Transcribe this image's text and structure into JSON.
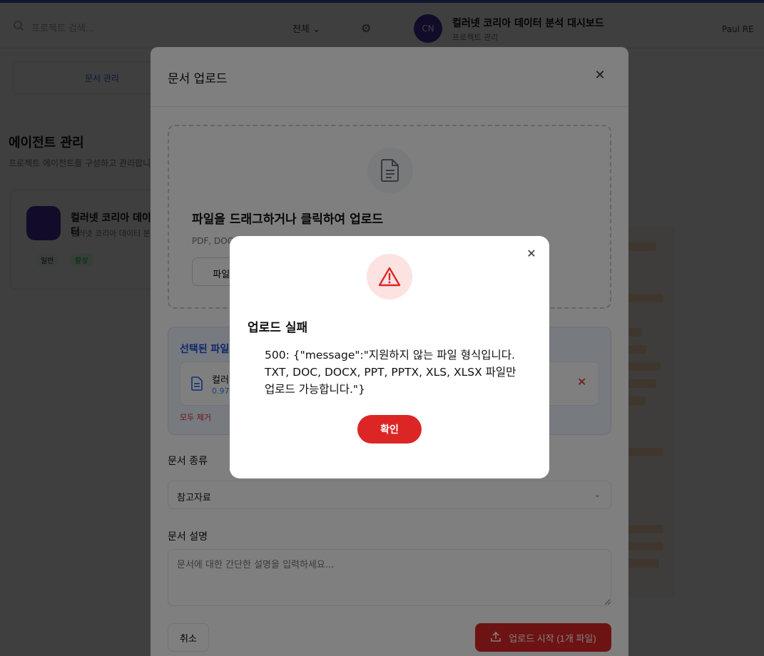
{
  "topbar": {
    "search_placeholder": "프로젝트 검색...",
    "filter_label": "전체",
    "project_logo": "CN",
    "project_title": "컬러넷 코리아 데이터 분석 대시보드",
    "project_subtitle": "프로젝트 관리",
    "user_label": "Paul RE"
  },
  "background": {
    "left_tab_label": "문서 관리",
    "page_heading": "에이전트 관리",
    "page_subheading": "프로젝트 에이전트를 구성하고 관리합니다",
    "card_title": "컬러넷 코리아 데이터",
    "card_subtitle": "컬러넷 코리아 데이터 분석",
    "badge_1": "일반",
    "badge_2": "활성"
  },
  "upload_modal": {
    "title": "문서 업로드",
    "dropzone_title": "파일을 드래그하거나 클릭하여 업로드",
    "dropzone_subtitle": "PDF, DOC, DOCX, XLS, XLSX, PPT, PPTX 파일 지원 (최대 50MB)",
    "select_button": "파일 선택",
    "selected_title": "선택된 파일",
    "file_name": "컬러넷_제안서.pdf",
    "file_size": "0.97 MB",
    "remove_all": "모두 제거",
    "doc_type_label": "문서 종류",
    "doc_type_value": "참고자료",
    "desc_label": "문서 설명",
    "desc_placeholder": "문서에 대한 간단한 설명을 입력하세요...",
    "cancel_button": "취소",
    "upload_button": "업로드 시작 (1개 파일)"
  },
  "alert": {
    "title": "업로드 실패",
    "message": "500: {\"message\":\"지원하지 않는 파일 형식입니다. TXT, DOC, DOCX, PPT, PPTX, XLS, XLSX 파일만 업로드 가능합니다.\"}",
    "confirm_button": "확인"
  },
  "colors": {
    "primary_red": "#dc2626",
    "alert_icon_bg": "#fde2e2",
    "selected_box_bg": "#eef4fc"
  },
  "icons": [
    "search-icon",
    "chevron-down-icon",
    "gear-icon",
    "close-icon",
    "document-icon",
    "warning-icon",
    "upload-icon"
  ]
}
